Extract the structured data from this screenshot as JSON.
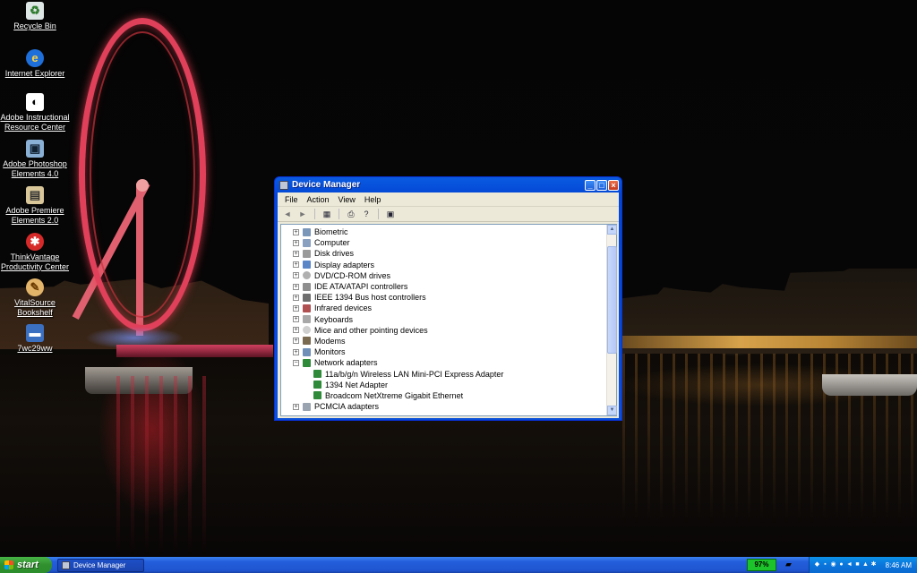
{
  "desktop": {
    "icons": [
      {
        "label": "Recycle Bin",
        "icon": "recycle-bin-icon"
      },
      {
        "label": "Internet Explorer",
        "icon": "internet-explorer-icon"
      },
      {
        "label": "Adobe Instructional Resource Center",
        "icon": "adobe-irc-icon"
      },
      {
        "label": "Adobe Photoshop Elements 4.0",
        "icon": "photoshop-elements-icon"
      },
      {
        "label": "Adobe Premiere Elements 2.0",
        "icon": "premiere-elements-icon"
      },
      {
        "label": "ThinkVantage Productivity Center",
        "icon": "thinkvantage-icon"
      },
      {
        "label": "VitalSource Bookshelf",
        "icon": "vitalsource-icon"
      },
      {
        "label": "7wc29ww",
        "icon": "shortcut-icon"
      }
    ]
  },
  "window": {
    "title": "Device Manager",
    "menu": [
      "File",
      "Action",
      "View",
      "Help"
    ],
    "tree": [
      {
        "label": "Biometric",
        "expanded": false
      },
      {
        "label": "Computer",
        "expanded": false
      },
      {
        "label": "Disk drives",
        "expanded": false
      },
      {
        "label": "Display adapters",
        "expanded": false
      },
      {
        "label": "DVD/CD-ROM drives",
        "expanded": false
      },
      {
        "label": "IDE ATA/ATAPI controllers",
        "expanded": false
      },
      {
        "label": "IEEE 1394 Bus host controllers",
        "expanded": false
      },
      {
        "label": "Infrared devices",
        "expanded": false
      },
      {
        "label": "Keyboards",
        "expanded": false
      },
      {
        "label": "Mice and other pointing devices",
        "expanded": false
      },
      {
        "label": "Modems",
        "expanded": false
      },
      {
        "label": "Monitors",
        "expanded": false
      },
      {
        "label": "Network adapters",
        "expanded": true
      },
      {
        "label": "11a/b/g/n Wireless LAN Mini-PCI Express Adapter",
        "child": true
      },
      {
        "label": "1394 Net Adapter",
        "child": true
      },
      {
        "label": "Broadcom NetXtreme Gigabit Ethernet",
        "child": true
      },
      {
        "label": "PCMCIA adapters",
        "expanded": false
      }
    ]
  },
  "taskbar": {
    "start_label": "start",
    "task_label": "Device Manager",
    "battery": "97%",
    "clock": "8:46 AM"
  },
  "colors": {
    "titlebar": "#0a50d8",
    "taskbar": "#245edb",
    "start": "#308f2e",
    "battery": "#1dc32a"
  }
}
